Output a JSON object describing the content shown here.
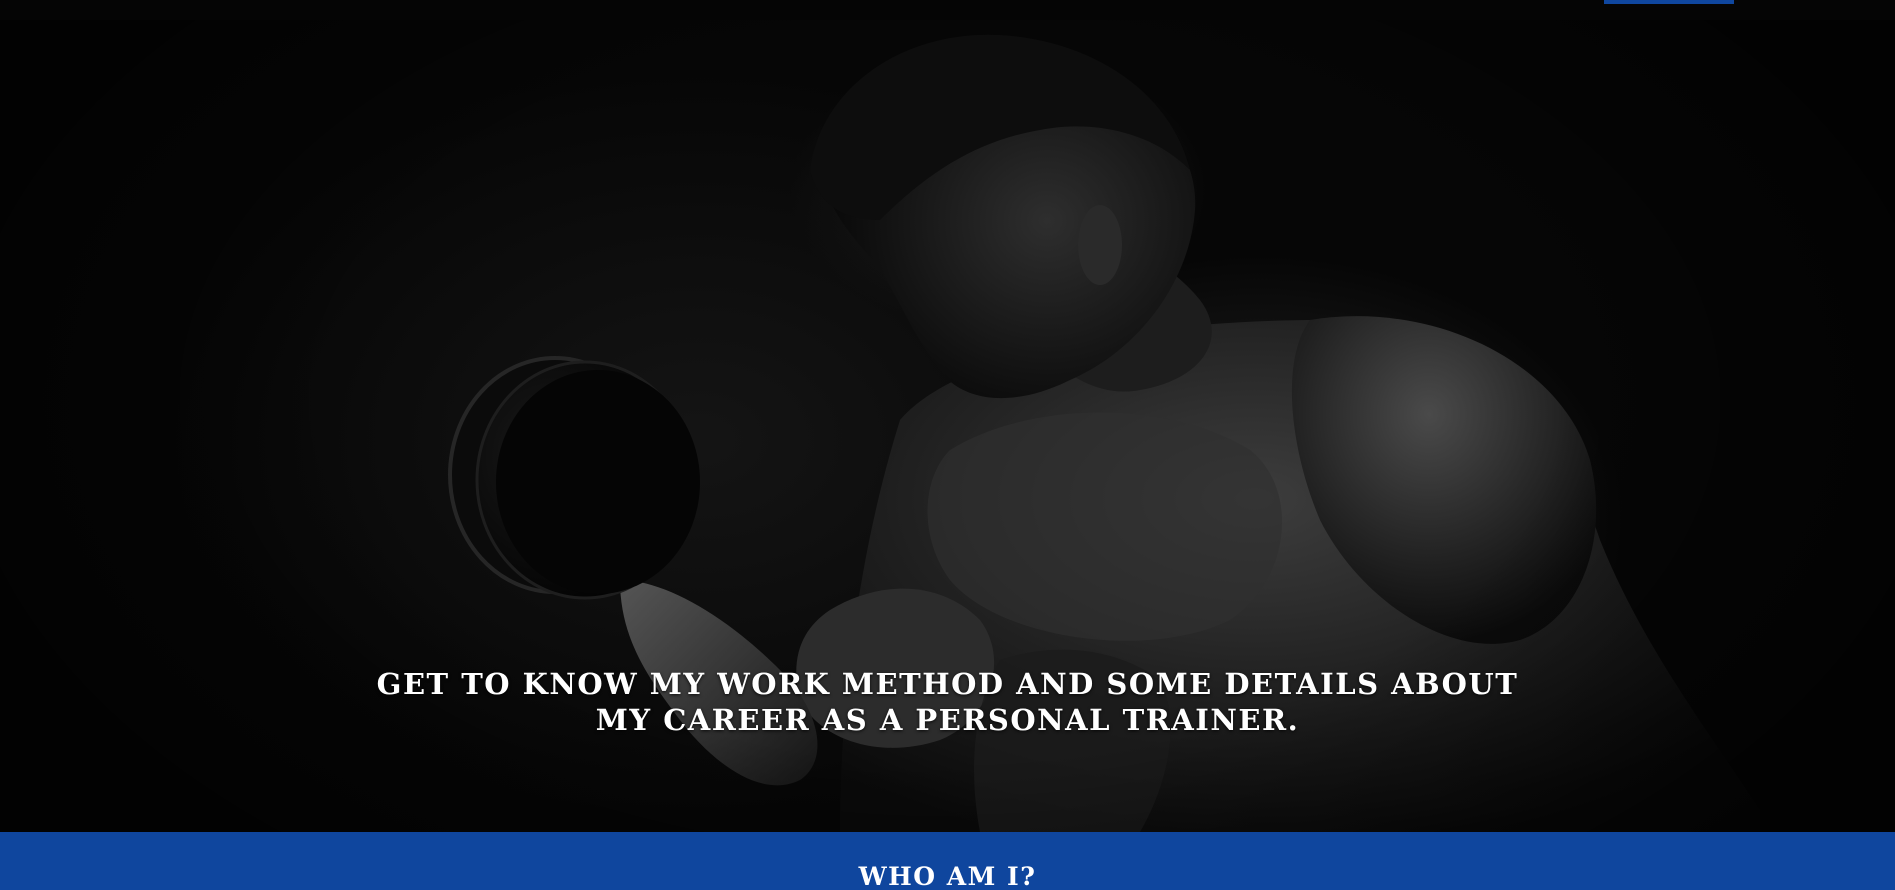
{
  "colors": {
    "brand_blue": "#0f469e",
    "hero_background": "#060606",
    "text": "#ffffff"
  },
  "hero": {
    "image": "bodybuilder-curling-dumbbell-photo",
    "line1": "GET TO KNOW MY WORK METHOD AND SOME DETAILS ABOUT",
    "line2": "MY CAREER AS A PERSONAL TRAINER."
  },
  "who_section": {
    "heading": "WHO AM I?"
  }
}
